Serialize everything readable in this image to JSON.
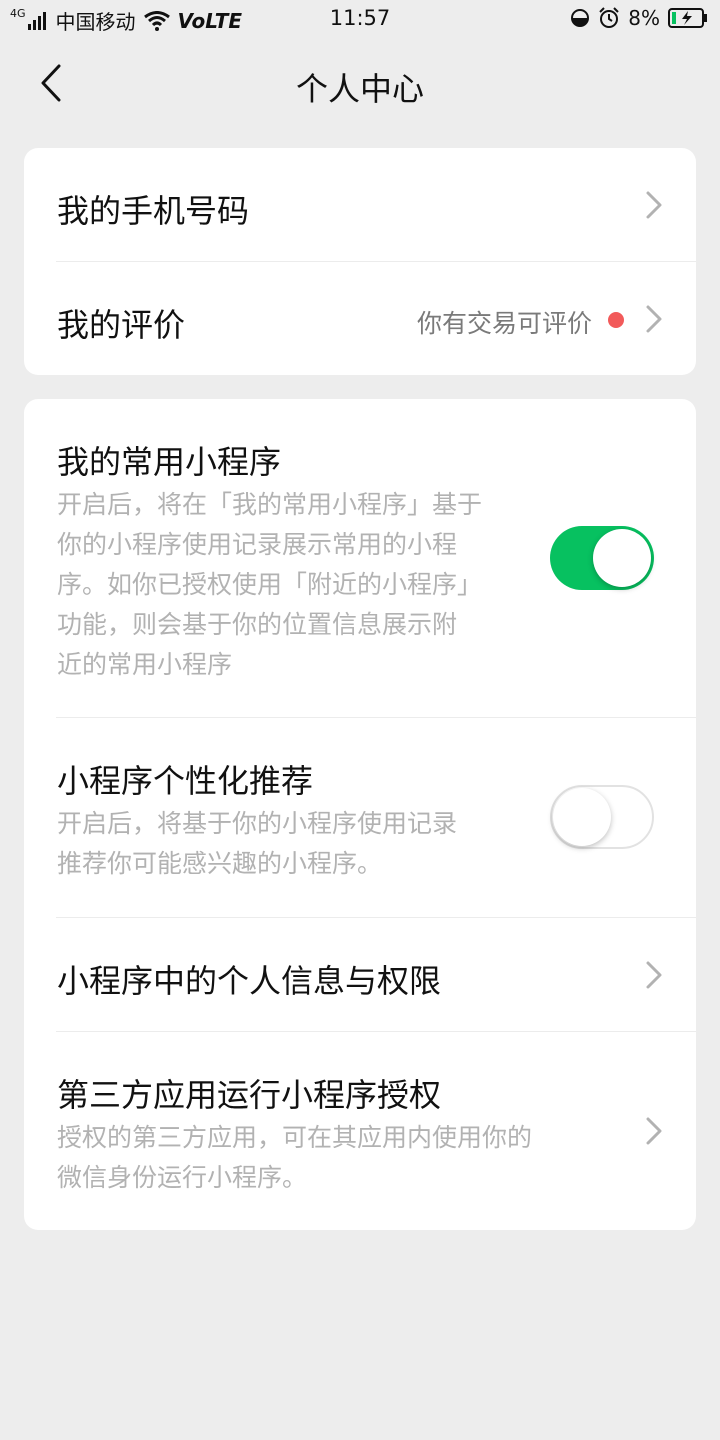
{
  "status_bar": {
    "network_type": "4G",
    "carrier": "中国移动",
    "volte": "VoLTE",
    "time": "11:57",
    "battery": "8%"
  },
  "nav": {
    "title": "个人中心"
  },
  "card1": {
    "phone": {
      "title": "我的手机号码"
    },
    "review": {
      "title": "我的评价",
      "hint": "你有交易可评价"
    }
  },
  "card2": {
    "common_miniprograms": {
      "title": "我的常用小程序",
      "desc_lines": [
        "开启后，将在「我的常用小程序」基于",
        "你的小程序使用记录展示常用的小程",
        "序。如你已授权使用「附近的小程序」",
        "功能，则会基于你的位置信息展示附",
        "近的常用小程序"
      ],
      "enabled": true
    },
    "personalized": {
      "title": "小程序个性化推荐",
      "desc_lines": [
        "开启后，将基于你的小程序使用记录",
        "推荐你可能感兴趣的小程序。"
      ],
      "enabled": false
    },
    "privacy": {
      "title": "小程序中的个人信息与权限"
    },
    "third_party": {
      "title": "第三方应用运行小程序授权",
      "desc_lines": [
        "授权的第三方应用，可在其应用内使用你的",
        "微信身份运行小程序。"
      ]
    }
  },
  "colors": {
    "accent_green": "#07c160",
    "red_dot": "#f25a5a",
    "background": "#ededed"
  }
}
